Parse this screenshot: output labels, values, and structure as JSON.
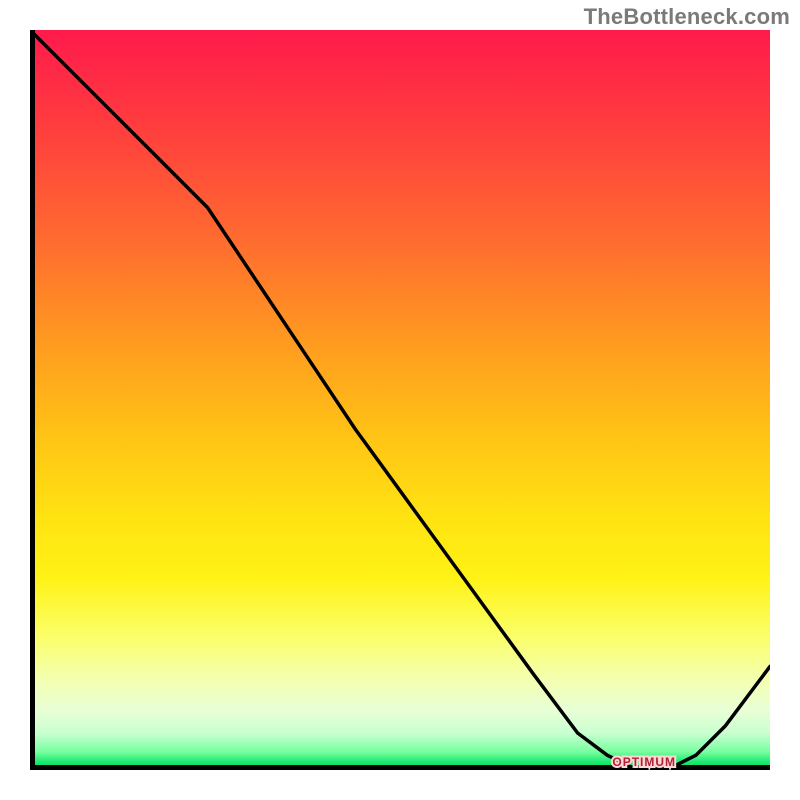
{
  "watermark": "TheBottleneck.com",
  "colors": {
    "top": "#ff1a4c",
    "mid": "#ffe312",
    "bottom": "#17e86e",
    "curve": "#000000",
    "axis": "#000000",
    "optimum_label": "#b02030"
  },
  "chart_data": {
    "type": "line",
    "title": "",
    "xlabel": "",
    "ylabel": "",
    "xlim": [
      0,
      100
    ],
    "ylim": [
      0,
      100
    ],
    "x": [
      0,
      8,
      16,
      24,
      28,
      36,
      44,
      52,
      60,
      68,
      74,
      78,
      82,
      86,
      90,
      94,
      100
    ],
    "values": [
      100,
      92,
      84,
      76,
      70,
      58,
      46,
      35,
      24,
      13,
      5,
      2,
      0,
      0,
      2,
      6,
      14
    ],
    "optimum": {
      "x_range": [
        78,
        88
      ],
      "y": 0,
      "label": "OPTIMUM"
    },
    "annotations": [
      {
        "text": "OPTIMUM",
        "x": 83,
        "y": 0
      }
    ]
  }
}
